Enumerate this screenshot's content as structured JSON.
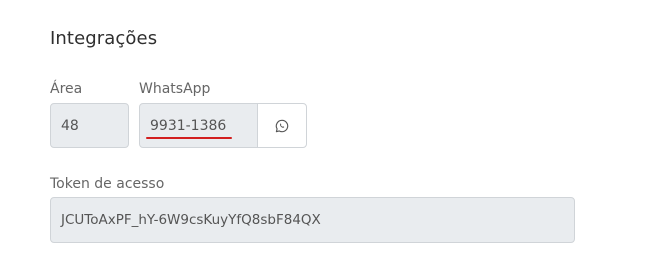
{
  "section": {
    "title": "Integrações"
  },
  "area": {
    "label": "Área",
    "value": "48"
  },
  "whatsapp": {
    "label": "WhatsApp",
    "value": "9931-1386",
    "button_icon": "whatsapp-icon"
  },
  "token": {
    "label": "Token de acesso",
    "value": "JCUToAxPF_hY-6W9csKuyYfQ8sbF84QX"
  },
  "colors": {
    "field_bg": "#e9ecef",
    "border": "#d0d4d8",
    "highlight_underline": "#d21f1f"
  }
}
